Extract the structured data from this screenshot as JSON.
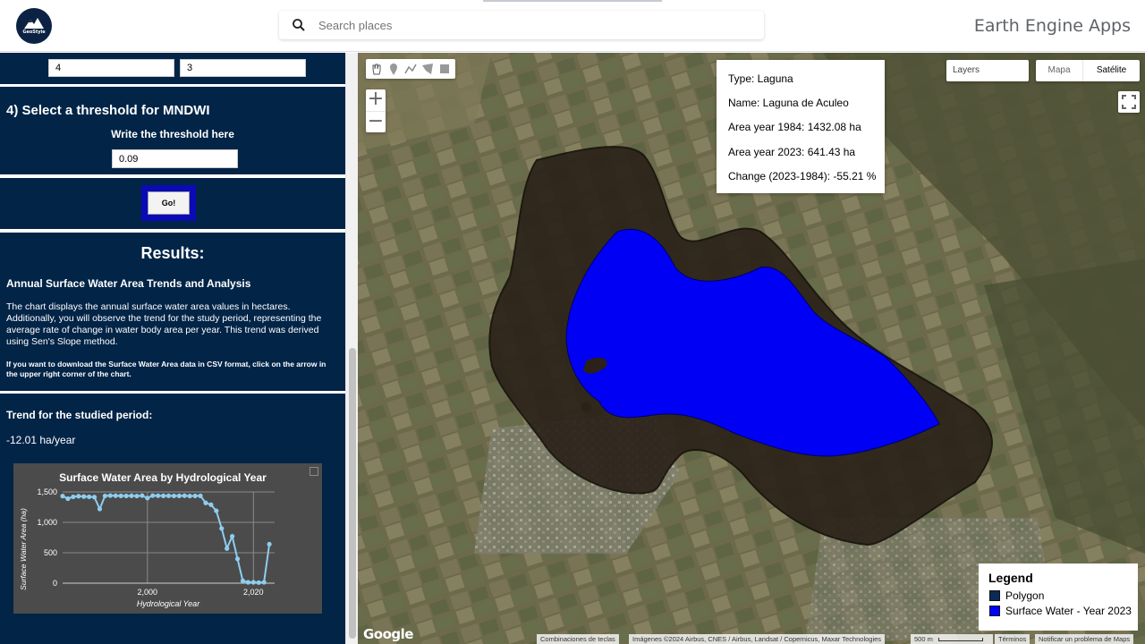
{
  "header": {
    "logo_text": "GeoStyle",
    "search_placeholder": "Search places",
    "app_title": "Earth Engine Apps"
  },
  "panel": {
    "input_a": "4",
    "input_b": "3",
    "threshold_heading": "4) Select a threshold for MNDWI",
    "threshold_label": "Write the threshold here",
    "threshold_value": "0.09",
    "go_label": "Go!",
    "results_heading": "Results:",
    "analysis_title": "Annual Surface Water Area Trends and Analysis",
    "analysis_text": "The chart displays the annual surface water area values in hectares. Additionally, you will observe the trend for the study period, representing the average rate of change in water body area per year. This trend was derived using Sen's Slope method.",
    "download_text": "If you want to download the Surface Water Area data in CSV format, click on the arrow in the upper right corner of the chart.",
    "trend_heading": "Trend for the studied period:",
    "trend_value": "-12.01 ha/year"
  },
  "chart_data": {
    "type": "line",
    "title": "Surface Water Area by Hydrological Year",
    "xlabel": "Hydrological Year",
    "ylabel": "Surface Water Area (ha)",
    "xlim": [
      1984,
      2024
    ],
    "ylim": [
      0,
      1500
    ],
    "x_ticks": [
      2000,
      2020
    ],
    "x_tick_labels": [
      "2,000",
      "2,020"
    ],
    "y_ticks": [
      0,
      500,
      1000,
      1500
    ],
    "y_tick_labels": [
      "0",
      "500",
      "1,000",
      "1,500"
    ],
    "series": [
      {
        "color": "#8ecdf0",
        "x": [
          1984,
          1985,
          1986,
          1987,
          1988,
          1989,
          1990,
          1991,
          1992,
          1993,
          1994,
          1995,
          1996,
          1997,
          1998,
          1999,
          2000,
          2001,
          2002,
          2003,
          2004,
          2005,
          2006,
          2007,
          2008,
          2009,
          2010,
          2011,
          2012,
          2013,
          2014,
          2015,
          2016,
          2017,
          2018,
          2019,
          2020,
          2021,
          2022,
          2023
        ],
        "values": [
          1432,
          1390,
          1420,
          1430,
          1425,
          1420,
          1415,
          1220,
          1435,
          1440,
          1438,
          1436,
          1435,
          1437,
          1433,
          1440,
          1400,
          1440,
          1438,
          1436,
          1437,
          1435,
          1436,
          1438,
          1433,
          1435,
          1436,
          1320,
          1290,
          1190,
          900,
          570,
          770,
          400,
          40,
          15,
          15,
          10,
          15,
          641
        ]
      }
    ],
    "grid": true,
    "legend": "none"
  },
  "map": {
    "draw_tools": [
      "hand-icon",
      "marker-icon",
      "polyline-icon",
      "polygon-icon",
      "rectangle-icon"
    ],
    "zoom_in": "+",
    "zoom_out": "−",
    "info": {
      "type": "Type: Laguna",
      "name": "Name: Laguna de Aculeo",
      "area_1984": "Area year 1984: 1432.08 ha",
      "area_2023": "Area year 2023: 641.43 ha",
      "change": "Change (2023-1984): -55.21 %"
    },
    "layers_label": "Layers",
    "maptype_map": "Mapa",
    "maptype_satellite": "Satélite",
    "legend_title": "Legend",
    "legend_items": [
      {
        "label": "Polygon",
        "color": "#0d2a55"
      },
      {
        "label": "Surface Water - Year 2023",
        "color": "#0000ff"
      }
    ],
    "google_logo": "Google",
    "attribution": {
      "shortcuts": "Combinaciones de teclas",
      "imagery": "Imágenes ©2024 Airbus, CNES / Airbus, Landsat / Copernicus, Maxar Technologies",
      "scale": "500 m",
      "terms": "Términos",
      "report": "Notificar un problema de Maps"
    }
  }
}
